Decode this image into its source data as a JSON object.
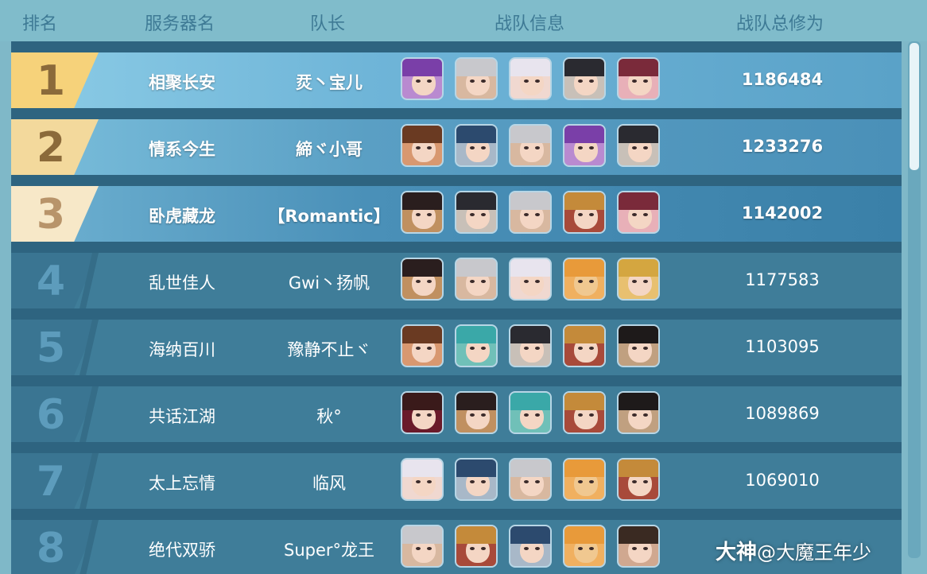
{
  "header": {
    "rank": "排名",
    "server": "服务器名",
    "captain": "队长",
    "team_info": "战队信息",
    "total_power": "战队总修为"
  },
  "rows": [
    {
      "rank": "1",
      "server": "相聚长安",
      "captain": "烎丶宝儿",
      "power": "1186484",
      "avatars": [
        "purple-hair-female-avatar",
        "silver-hair-male-avatar",
        "white-hair-female-avatar",
        "dark-hair-male-avatar",
        "pink-female-avatar"
      ]
    },
    {
      "rank": "2",
      "server": "情系今生",
      "captain": "締ヾ小哥",
      "power": "1233276",
      "avatars": [
        "brown-hair-female-avatar",
        "blue-hair-male-avatar",
        "silver-hair-male-avatar",
        "purple-hair-female-avatar",
        "dark-hair-male-avatar"
      ]
    },
    {
      "rank": "3",
      "server": "卧虎藏龙",
      "captain": "【Romantic】",
      "power": "1142002",
      "avatars": [
        "dark-hair-female-avatar",
        "dark-hair-male-avatar",
        "silver-hair-male-avatar",
        "warrior-male-avatar",
        "pink-female-avatar"
      ]
    },
    {
      "rank": "4",
      "server": "乱世佳人",
      "captain": "Gwi丶扬帆",
      "power": "1177583",
      "avatars": [
        "dark-hair-female-avatar",
        "silver-hair-male-avatar",
        "white-hair-female-avatar",
        "tiger-avatar",
        "golden-crown-male-avatar"
      ]
    },
    {
      "rank": "5",
      "server": "海纳百川",
      "captain": "豫静不止ヾ",
      "power": "1103095",
      "avatars": [
        "brown-hair-female-avatar",
        "teal-crown-male-avatar",
        "dark-hair-male-avatar",
        "warrior-male-avatar",
        "young-male-avatar"
      ]
    },
    {
      "rank": "6",
      "server": "共话江湖",
      "captain": "秋°",
      "power": "1089869",
      "avatars": [
        "red-eyes-avatar",
        "dark-hair-female-avatar",
        "teal-crown-male-avatar",
        "warrior-male-avatar",
        "young-male-avatar"
      ]
    },
    {
      "rank": "7",
      "server": "太上忘情",
      "captain": "临风",
      "power": "1069010",
      "avatars": [
        "white-hair-female-avatar",
        "blue-hair-male-avatar",
        "silver-hair-male-avatar",
        "tiger-avatar",
        "warrior-male-avatar"
      ]
    },
    {
      "rank": "8",
      "server": "绝代双骄",
      "captain": "Super°龙王",
      "power": "",
      "avatars": [
        "silver-hair-male-avatar",
        "warrior-male-avatar",
        "blue-hair-male-avatar",
        "tiger-avatar",
        "winking-female-avatar"
      ]
    }
  ],
  "watermark": {
    "brand": "大神",
    "handle": "@大魔王年少"
  },
  "colors": {
    "gold1": "#f6d27a",
    "gold2": "#f3d99c",
    "gold3": "#f7e8c8",
    "row_bg": "#3f7d99",
    "header_bg": "#80bccb"
  }
}
